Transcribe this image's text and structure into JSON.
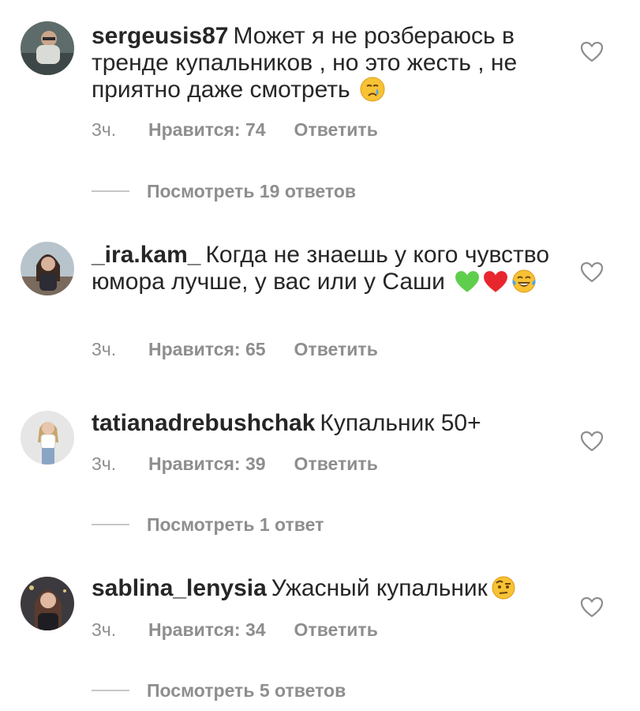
{
  "comments": [
    {
      "username": "sergeusis87",
      "text": "Может я не розбераюсь в тренде купальников , но это жесть , не приятно даже смотреть",
      "emoji_icons": [
        "crying-face-icon"
      ],
      "time": "3ч.",
      "likes": "Нравится: 74",
      "reply": "Ответить",
      "view_replies": "Посмотреть 19 ответов"
    },
    {
      "username": "_ira.kam_",
      "text": "Когда не знаешь у кого чувство юмора лучше, у вас или у Саши",
      "emoji_icons": [
        "green-heart-icon",
        "red-heart-icon",
        "tears-of-joy-icon"
      ],
      "time": "3ч.",
      "likes": "Нравится: 65",
      "reply": "Ответить"
    },
    {
      "username": "tatianadrebushchak",
      "text": "Купальник 50+",
      "emoji_icons": [],
      "time": "3ч.",
      "likes": "Нравится: 39",
      "reply": "Ответить",
      "view_replies": "Посмотреть 1 ответ"
    },
    {
      "username": "sablina_lenysia",
      "text": "Ужасный купальник",
      "emoji_icons": [
        "face-with-raised-eyebrow-icon"
      ],
      "time": "3ч.",
      "likes": "Нравится: 34",
      "reply": "Ответить",
      "view_replies": "Посмотреть 5 ответов"
    }
  ],
  "colors": {
    "text": "#262626",
    "secondary": "#8e8e8e",
    "divider": "#c7c7c7"
  },
  "icons": {
    "like": "heart-outline-icon"
  }
}
